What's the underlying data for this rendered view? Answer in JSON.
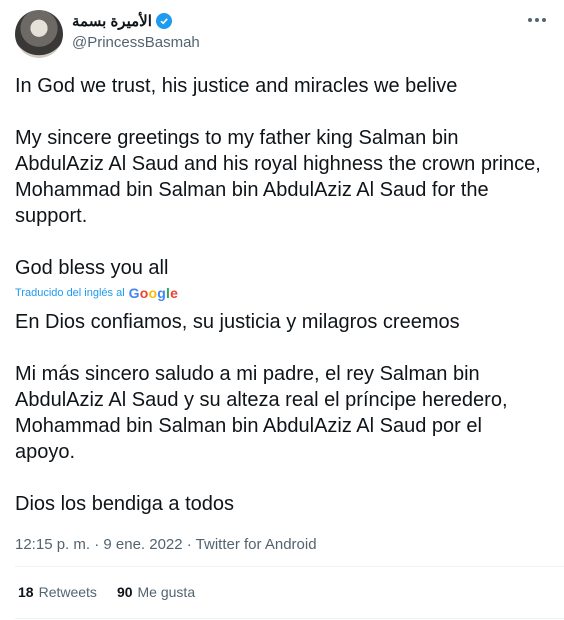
{
  "author": {
    "display_name": "الأميرة بسمة",
    "handle": "@PrincessBasmah"
  },
  "tweet": {
    "text": "In God we trust, his justice and miracles we belive\n\nMy sincere greetings to my father king Salman bin AbdulAziz Al Saud and his royal highness the crown prince, Mohammad bin Salman bin AbdulAziz Al Saud for the support.\n\nGod bless you all",
    "translated_by_label": "Traducido del inglés al",
    "translation_provider": "Google",
    "translation": "En Dios confiamos, su justicia y milagros creemos\n\n Mi más sincero saludo a mi padre, el rey Salman bin AbdulAziz Al Saud y su alteza real el príncipe heredero, Mohammad bin Salman bin AbdulAziz Al Saud por el apoyo.\n\n Dios los bendiga a todos"
  },
  "meta": {
    "timestamp": "12:15 p. m. · 9 ene. 2022 · Twitter for Android"
  },
  "stats": {
    "retweets_count": "18",
    "retweets_label": "Retweets",
    "likes_count": "90",
    "likes_label": "Me gusta"
  },
  "colors": {
    "verified": "#1d9bf0",
    "link": "#1d9bf0",
    "secondary_text": "#536471"
  }
}
